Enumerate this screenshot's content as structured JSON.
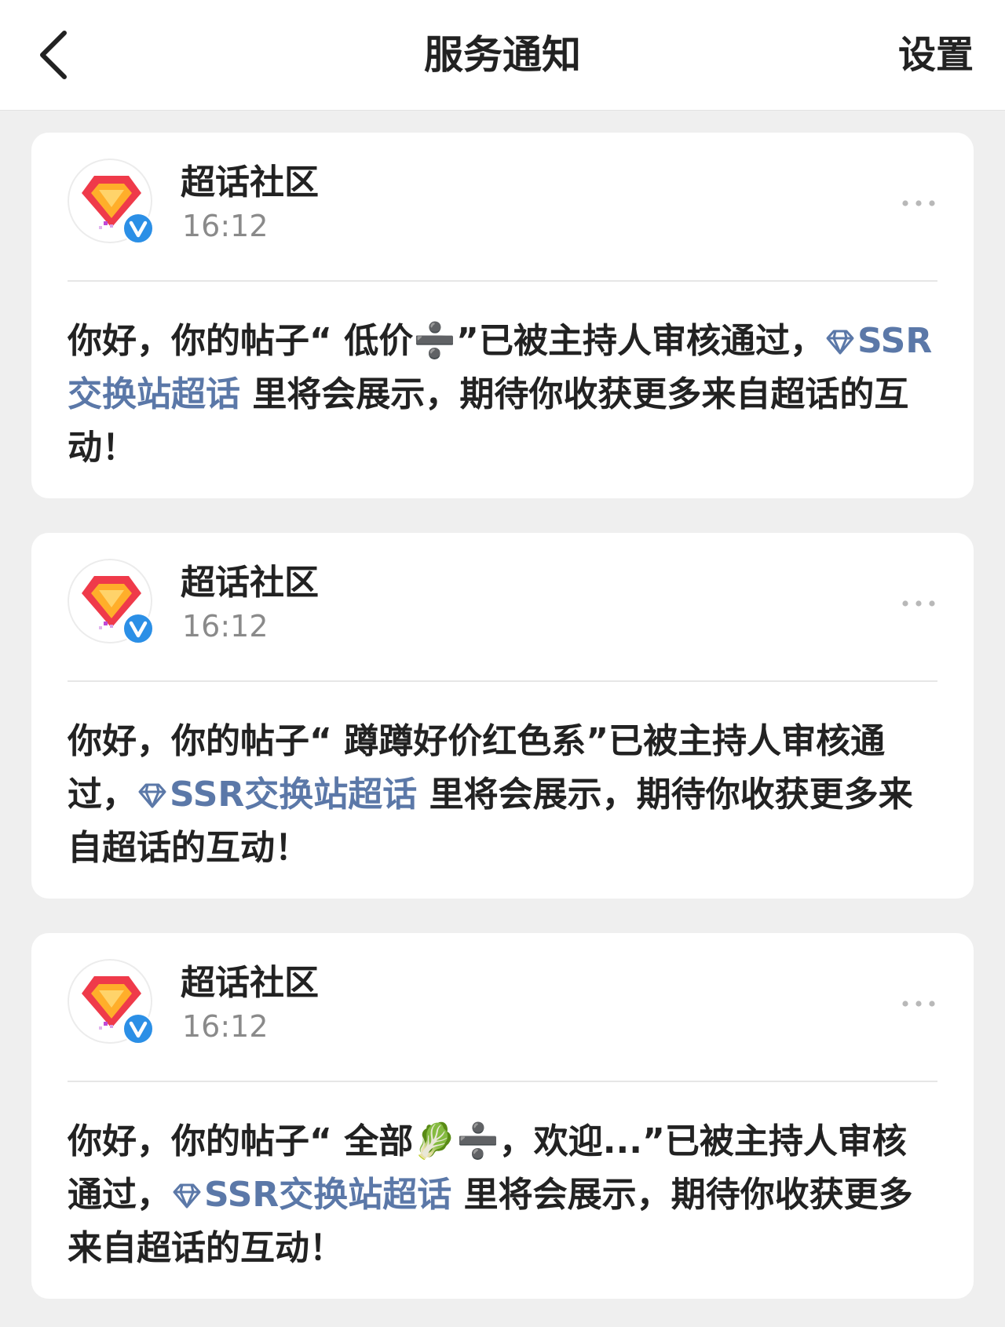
{
  "header": {
    "title": "服务通知",
    "settings_label": "设置"
  },
  "notifications": [
    {
      "sender": "超话社区",
      "time": "16:12",
      "text_before": "你好，你的帖子“ 低价➗”已被主持人审核通过，",
      "topic": "SSR交换站超话",
      "text_after": " 里将会展示，期待你收获更多来自超话的互动！"
    },
    {
      "sender": "超话社区",
      "time": "16:12",
      "text_before": "你好，你的帖子“ 蹲蹲好价红色系”已被主持人审核通过，",
      "topic": "SSR交换站超话",
      "text_after": " 里将会展示，期待你收获更多来自超话的互动！"
    },
    {
      "sender": "超话社区",
      "time": "16:12",
      "text_before": "你好，你的帖子“ 全部🥬➗，欢迎...”已被主持人审核通过，",
      "topic": "SSR交换站超话",
      "text_after": " 里将会展示，期待你收获更多来自超话的互动！"
    }
  ],
  "colors": {
    "link": "#5b78a8",
    "verify": "#2b8fe6",
    "logo_red": "#ef3a4a",
    "logo_orange": "#ffae2a"
  },
  "icons": {
    "back": "chevron-left-icon",
    "more": "more-horizontal-icon",
    "verify": "verified-badge-icon",
    "topic": "diamond-icon"
  }
}
